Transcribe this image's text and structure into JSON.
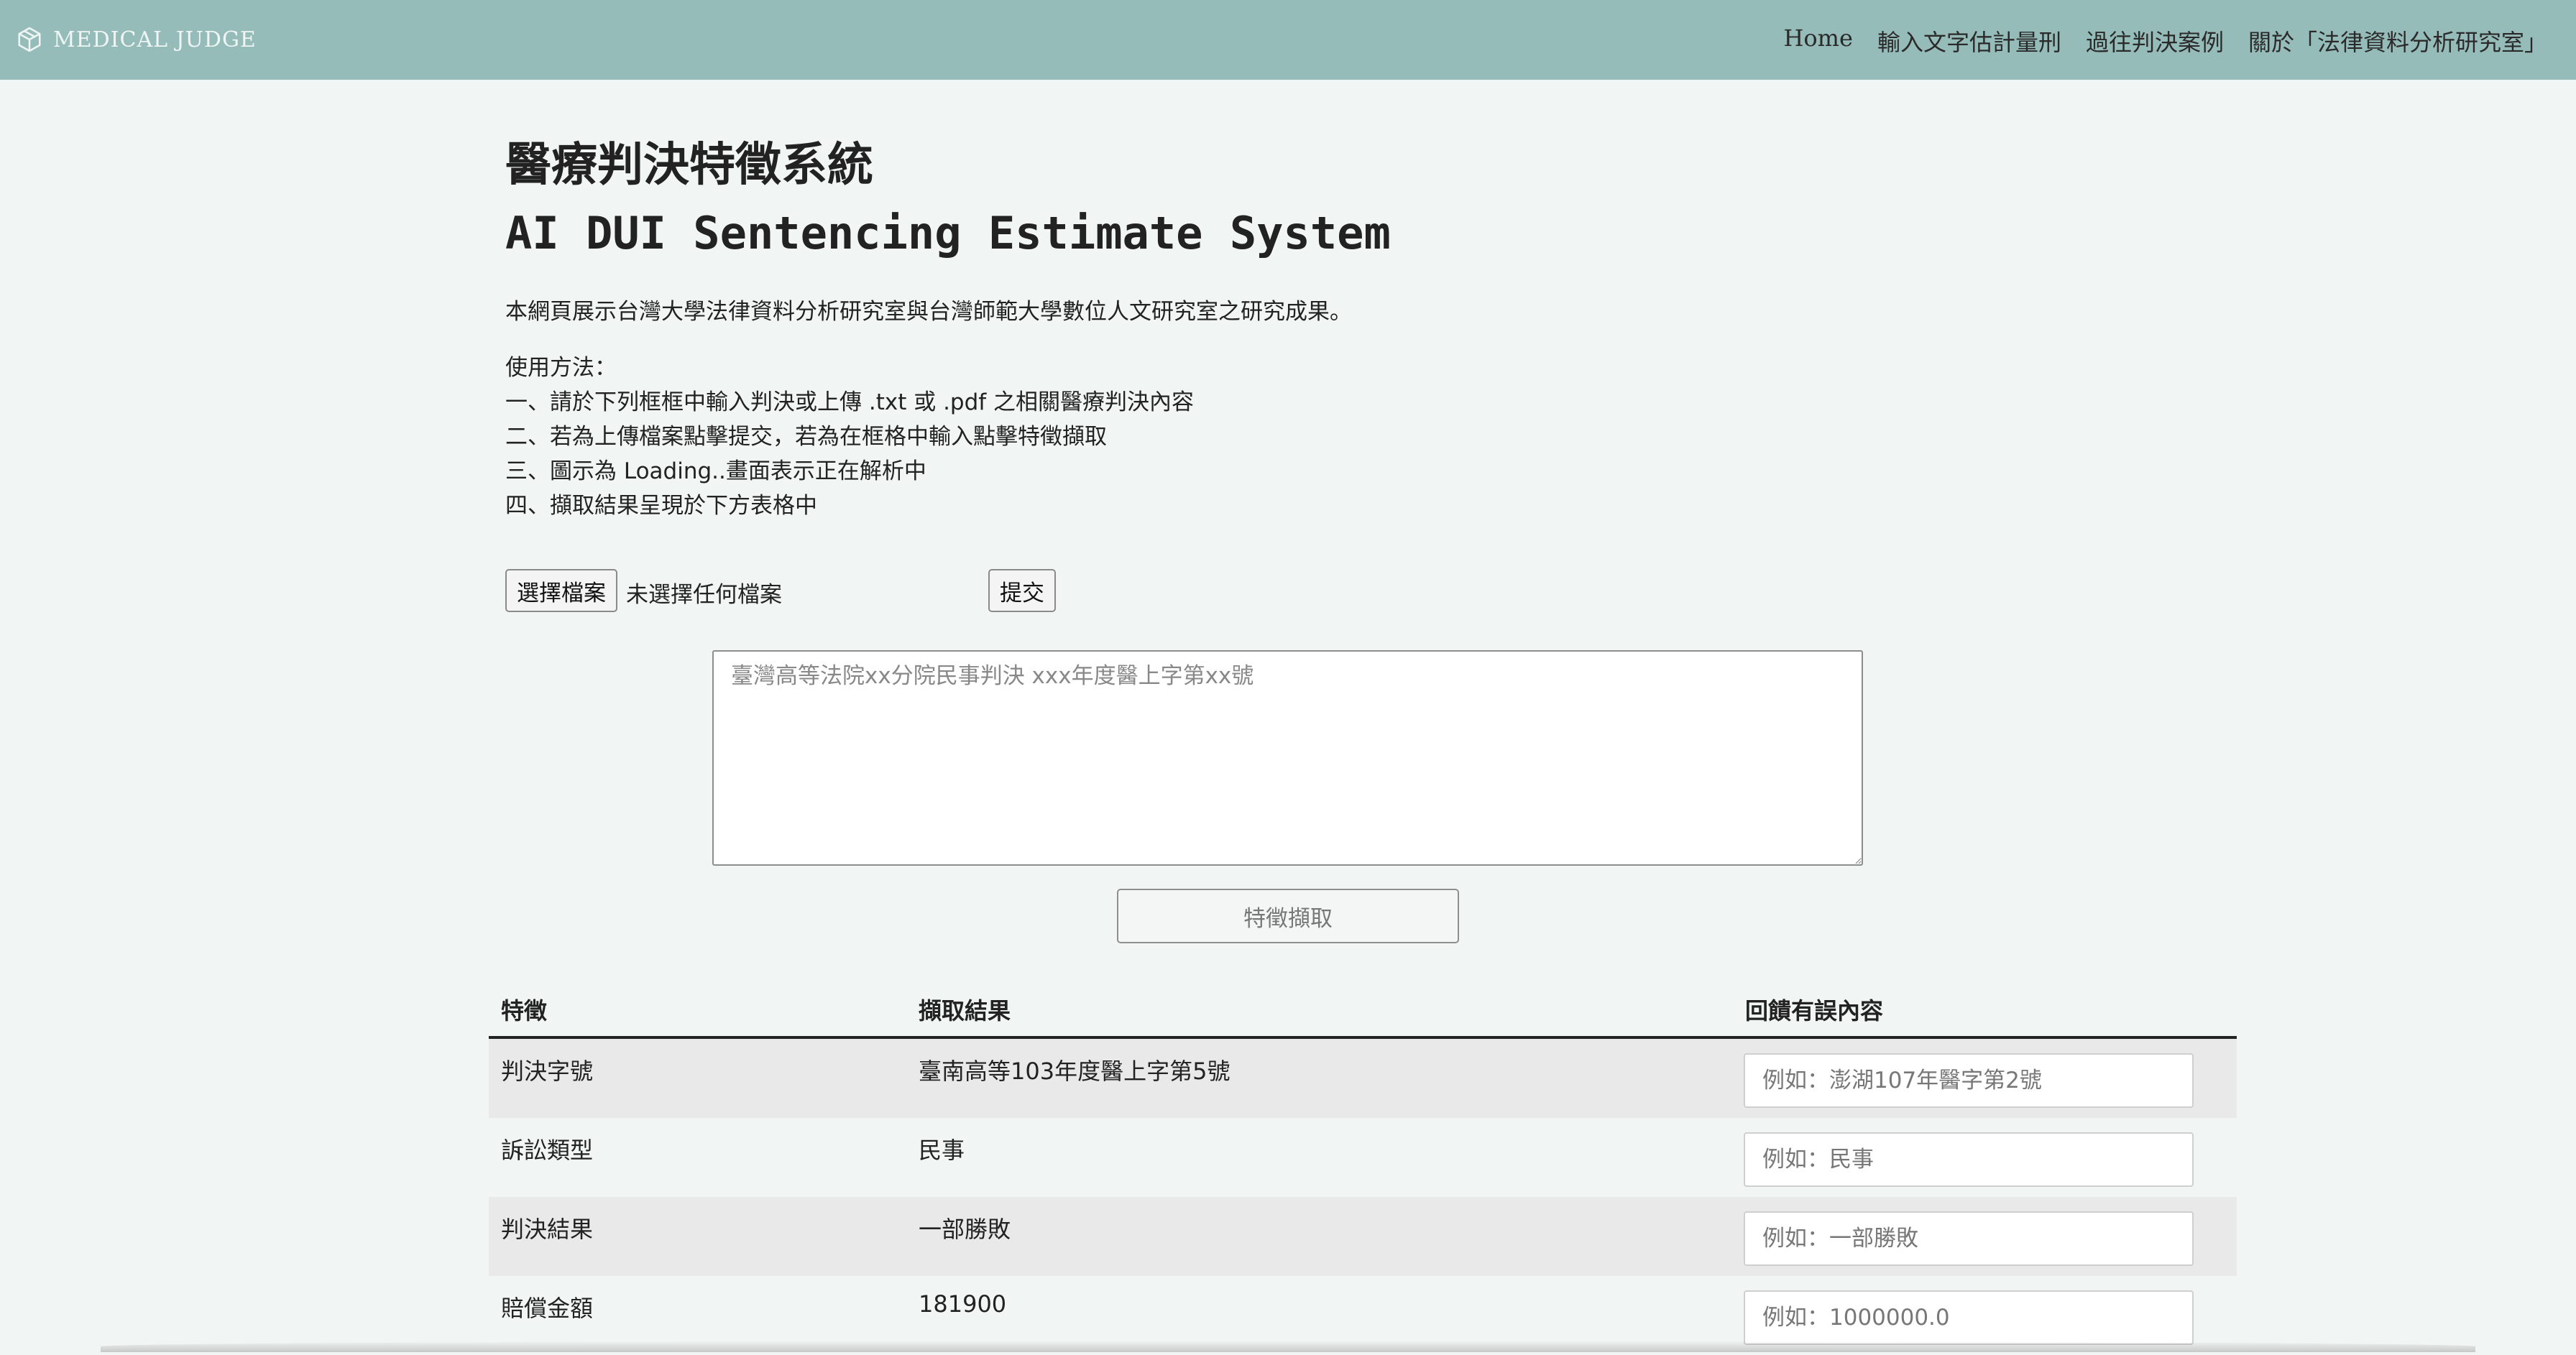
{
  "navbar": {
    "brand": "MEDICAL JUDGE",
    "brand_icon": "cube-icon",
    "links": [
      "Home",
      "輸入文字估計量刑",
      "過往判決案例",
      "關於「法律資料分析研究室」"
    ]
  },
  "header": {
    "title_zh": "醫療判決特徵系統",
    "title_en": "AI DUI Sentencing Estimate System"
  },
  "intro": "本網頁展示台灣大學法律資料分析研究室與台灣師範大學數位人文研究室之研究成果。",
  "usage": {
    "heading": "使用方法：",
    "steps": [
      "一、請於下列框框中輸入判決或上傳 .txt 或 .pdf 之相關醫療判決內容",
      "二、若為上傳檔案點擊提交，若為在框格中輸入點擊特徵擷取",
      "三、圖示為 Loading..畫面表示正在解析中",
      "四、擷取結果呈現於下方表格中"
    ]
  },
  "upload": {
    "choose_label": "選擇檔案",
    "status": "未選擇任何檔案",
    "submit_label": "提交"
  },
  "judgment_input": {
    "placeholder": "臺灣高等法院xx分院民事判決 xxx年度醫上字第xx號",
    "value": ""
  },
  "extract_button": "特徵擷取",
  "table": {
    "headers": [
      "特徵",
      "擷取結果",
      "回饋有誤內容"
    ],
    "rows": [
      {
        "feature": "判決字號",
        "result": "臺南高等103年度醫上字第5號",
        "feedback_placeholder": "例如：澎湖107年醫字第2號"
      },
      {
        "feature": "訴訟類型",
        "result": "民事",
        "feedback_placeholder": "例如：民事"
      },
      {
        "feature": "判決結果",
        "result": "一部勝敗",
        "feedback_placeholder": "例如：一部勝敗"
      },
      {
        "feature": "賠償金額",
        "result": "181900",
        "feedback_placeholder": "例如：1000000.0"
      }
    ]
  }
}
